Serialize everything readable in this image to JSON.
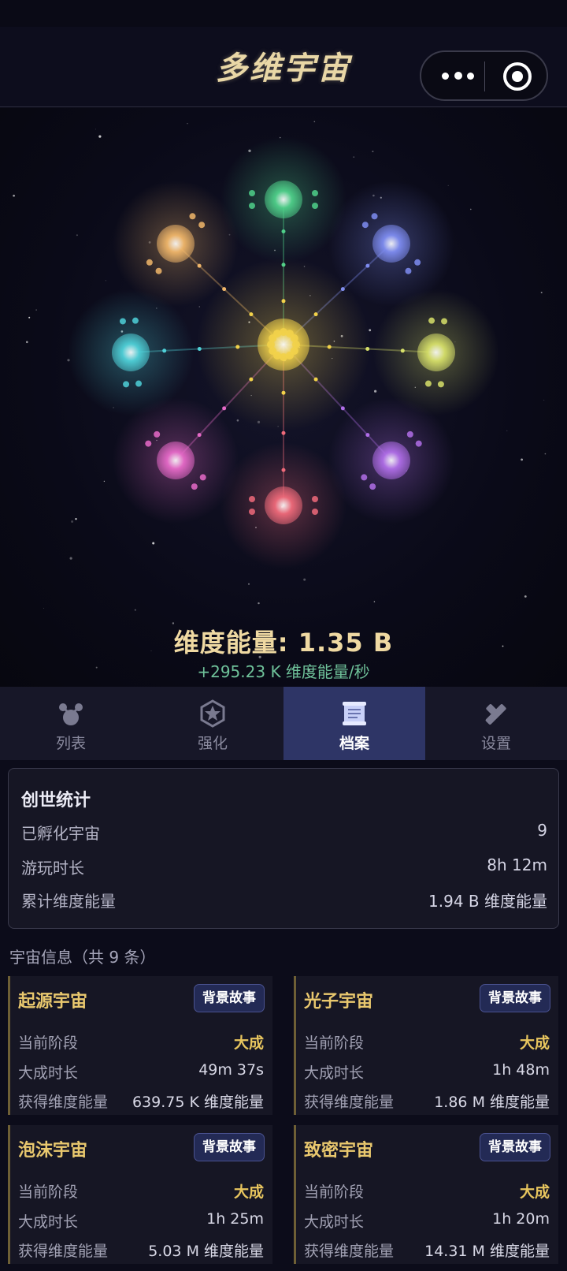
{
  "app": {
    "title": "多维宇宙"
  },
  "capsule": {
    "more_icon": "more-dots-icon",
    "close_icon": "record-circle-icon"
  },
  "resources": {
    "energy_label": "维度能量: 1.35 B",
    "rate_label": "+295.23 K 维度能量/秒"
  },
  "universe_nodes": [
    {
      "name": "green",
      "color": "#4fd08a"
    },
    {
      "name": "blue",
      "color": "#7e8cf0"
    },
    {
      "name": "yellow",
      "color": "#d7e06a"
    },
    {
      "name": "purple",
      "color": "#b06ee8"
    },
    {
      "name": "red",
      "color": "#ef6a7a"
    },
    {
      "name": "magenta",
      "color": "#e66ac8"
    },
    {
      "name": "cyan",
      "color": "#4fd0d8"
    },
    {
      "name": "orange",
      "color": "#f0b66a"
    },
    {
      "name": "core",
      "color": "#f2d24a"
    }
  ],
  "tabs": [
    {
      "label": "列表",
      "icon": "universe-list-icon",
      "active": false
    },
    {
      "label": "强化",
      "icon": "star-badge-icon",
      "active": false
    },
    {
      "label": "档案",
      "icon": "archive-icon",
      "active": true
    },
    {
      "label": "设置",
      "icon": "wrench-icon",
      "active": false
    }
  ],
  "stats": {
    "title": "创世统计",
    "rows": [
      {
        "label": "已孵化宇宙",
        "value": "9"
      },
      {
        "label": "游玩时长",
        "value": "8h 12m"
      },
      {
        "label": "累计维度能量",
        "value": "1.94 B 维度能量"
      }
    ]
  },
  "universe_info": {
    "title": "宇宙信息（共 9 条）",
    "button_label": "背景故事",
    "cards": [
      {
        "name": "起源宇宙",
        "rows": [
          {
            "k": "当前阶段",
            "v": "大成"
          },
          {
            "k": "大成时长",
            "v": "49m 37s"
          },
          {
            "k": "获得维度能量",
            "v": "639.75 K 维度能量"
          }
        ]
      },
      {
        "name": "光子宇宙",
        "rows": [
          {
            "k": "当前阶段",
            "v": "大成"
          },
          {
            "k": "大成时长",
            "v": "1h 48m"
          },
          {
            "k": "获得维度能量",
            "v": "1.86 M 维度能量"
          }
        ]
      },
      {
        "name": "泡沫宇宙",
        "rows": [
          {
            "k": "当前阶段",
            "v": "大成"
          },
          {
            "k": "大成时长",
            "v": "1h 25m"
          },
          {
            "k": "获得维度能量",
            "v": "5.03 M 维度能量"
          }
        ]
      },
      {
        "name": "致密宇宙",
        "rows": [
          {
            "k": "当前阶段",
            "v": "大成"
          },
          {
            "k": "大成时长",
            "v": "1h 20m"
          },
          {
            "k": "获得维度能量",
            "v": "14.31 M 维度能量"
          }
        ]
      }
    ]
  }
}
